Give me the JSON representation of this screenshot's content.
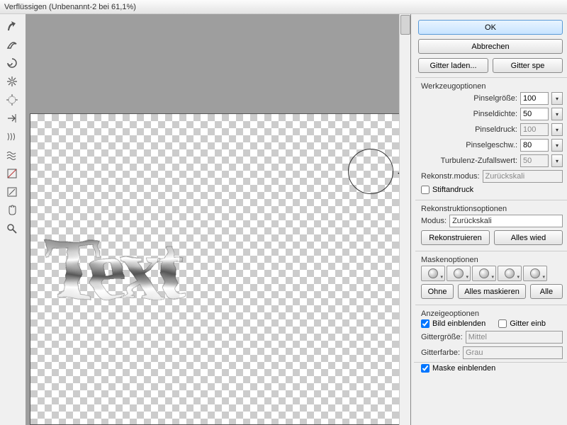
{
  "title": "Verflüssigen (Unbenannt-2 bei 61,1%)",
  "canvas_text": "Text",
  "buttons": {
    "ok": "OK",
    "cancel": "Abbrechen",
    "load_mesh": "Gitter laden...",
    "save_mesh": "Gitter spe",
    "reconstruct": "Rekonstruieren",
    "restore_all": "Alles wied",
    "none": "Ohne",
    "mask_all": "Alles maskieren",
    "invert_all": "Alle"
  },
  "groups": {
    "tool_options": "Werkzeugoptionen",
    "reconstruct_options": "Rekonstruktionsoptionen",
    "mask_options": "Maskenoptionen",
    "view_options": "Anzeigeoptionen"
  },
  "labels": {
    "brush_size": "Pinselgröße:",
    "brush_density": "Pinseldichte:",
    "brush_pressure": "Pinseldruck:",
    "brush_rate": "Pinselgeschw.:",
    "turbulence": "Turbulenz-Zufallswert:",
    "reconstruct_mode": "Rekonstr.modus:",
    "stylus": "Stiftandruck",
    "modus": "Modus:",
    "show_image": "Bild einblenden",
    "show_mesh": "Gitter einb",
    "mesh_size": "Gittergröße:",
    "mesh_color": "Gitterfarbe:",
    "show_mask": "Maske einblenden"
  },
  "values": {
    "brush_size": "100",
    "brush_density": "50",
    "brush_pressure": "100",
    "brush_rate": "80",
    "turbulence": "50",
    "reconstruct_mode": "Zurückskali",
    "modus": "Zurückskali",
    "mesh_size": "Mittel",
    "mesh_color": "Grau"
  },
  "checks": {
    "stylus": false,
    "show_image": true,
    "show_mesh": false,
    "show_mask": true
  }
}
